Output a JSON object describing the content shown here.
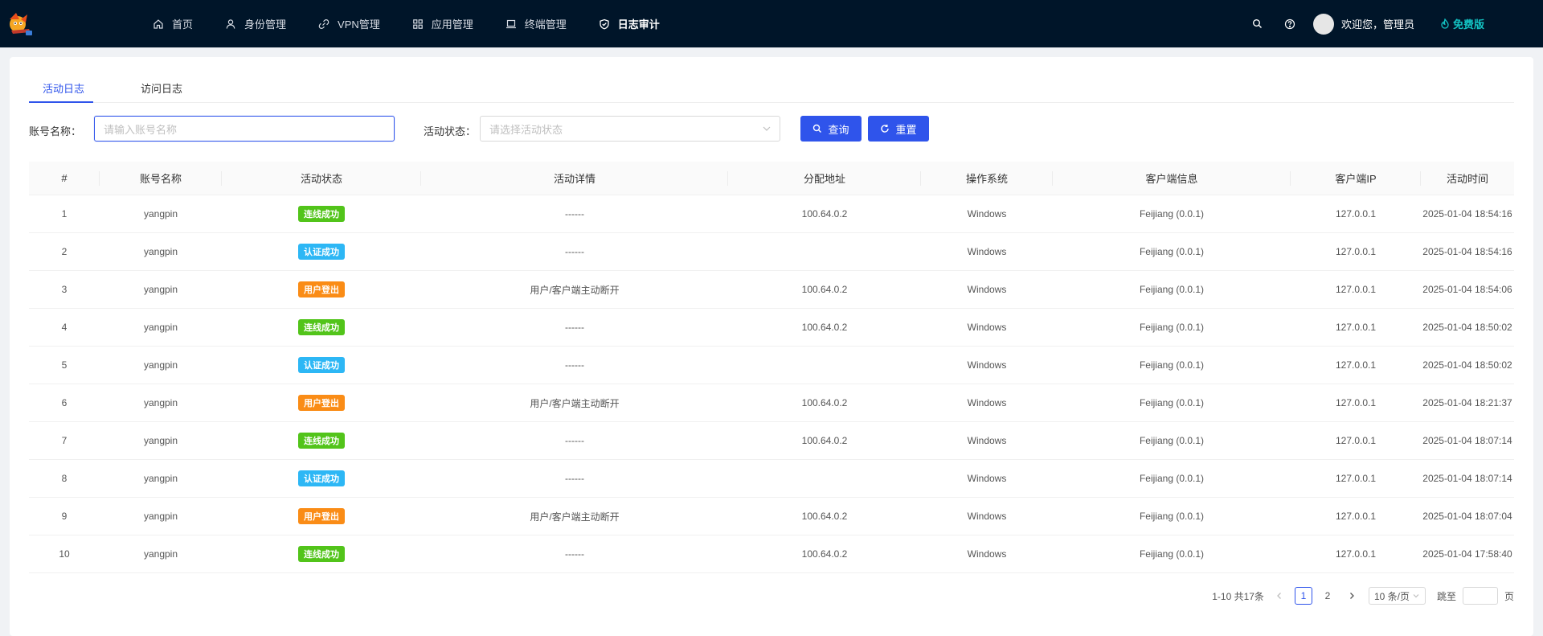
{
  "nav": {
    "items": [
      {
        "label": "首页",
        "icon": "home-icon"
      },
      {
        "label": "身份管理",
        "icon": "user-icon"
      },
      {
        "label": "VPN管理",
        "icon": "link-icon"
      },
      {
        "label": "应用管理",
        "icon": "apps-icon"
      },
      {
        "label": "终端管理",
        "icon": "laptop-icon"
      },
      {
        "label": "日志审计",
        "icon": "shield-icon",
        "active": true
      }
    ]
  },
  "header": {
    "welcome": "欢迎您，管理员",
    "edition": "免费版"
  },
  "tabs": [
    "活动日志",
    "访问日志"
  ],
  "filters": {
    "account_label": "账号名称：",
    "account_placeholder": "请输入账号名称",
    "status_label": "活动状态：",
    "status_placeholder": "请选择活动状态",
    "search_label": "查询",
    "reset_label": "重置"
  },
  "colors": {
    "accent": "#2f54eb",
    "success": "#52c41a",
    "auth": "#2db7f5",
    "logout": "#fa8c16"
  },
  "table": {
    "columns": [
      "#",
      "账号名称",
      "活动状态",
      "活动详情",
      "分配地址",
      "操作系统",
      "客户端信息",
      "客户端IP",
      "活动时间"
    ],
    "rows": [
      {
        "no": "1",
        "account": "yangpin",
        "status": "连线成功",
        "status_type": "success",
        "detail": "------",
        "address": "100.64.0.2",
        "os": "Windows",
        "client": "Feijiang (0.0.1)",
        "ip": "127.0.0.1",
        "time": "2025-01-04 18:54:16"
      },
      {
        "no": "2",
        "account": "yangpin",
        "status": "认证成功",
        "status_type": "auth",
        "detail": "------",
        "address": "",
        "os": "Windows",
        "client": "Feijiang (0.0.1)",
        "ip": "127.0.0.1",
        "time": "2025-01-04 18:54:16"
      },
      {
        "no": "3",
        "account": "yangpin",
        "status": "用户登出",
        "status_type": "logout",
        "detail": "用户/客户端主动断开",
        "address": "100.64.0.2",
        "os": "Windows",
        "client": "Feijiang (0.0.1)",
        "ip": "127.0.0.1",
        "time": "2025-01-04 18:54:06"
      },
      {
        "no": "4",
        "account": "yangpin",
        "status": "连线成功",
        "status_type": "success",
        "detail": "------",
        "address": "100.64.0.2",
        "os": "Windows",
        "client": "Feijiang (0.0.1)",
        "ip": "127.0.0.1",
        "time": "2025-01-04 18:50:02"
      },
      {
        "no": "5",
        "account": "yangpin",
        "status": "认证成功",
        "status_type": "auth",
        "detail": "------",
        "address": "",
        "os": "Windows",
        "client": "Feijiang (0.0.1)",
        "ip": "127.0.0.1",
        "time": "2025-01-04 18:50:02"
      },
      {
        "no": "6",
        "account": "yangpin",
        "status": "用户登出",
        "status_type": "logout",
        "detail": "用户/客户端主动断开",
        "address": "100.64.0.2",
        "os": "Windows",
        "client": "Feijiang (0.0.1)",
        "ip": "127.0.0.1",
        "time": "2025-01-04 18:21:37"
      },
      {
        "no": "7",
        "account": "yangpin",
        "status": "连线成功",
        "status_type": "success",
        "detail": "------",
        "address": "100.64.0.2",
        "os": "Windows",
        "client": "Feijiang (0.0.1)",
        "ip": "127.0.0.1",
        "time": "2025-01-04 18:07:14"
      },
      {
        "no": "8",
        "account": "yangpin",
        "status": "认证成功",
        "status_type": "auth",
        "detail": "------",
        "address": "",
        "os": "Windows",
        "client": "Feijiang (0.0.1)",
        "ip": "127.0.0.1",
        "time": "2025-01-04 18:07:14"
      },
      {
        "no": "9",
        "account": "yangpin",
        "status": "用户登出",
        "status_type": "logout",
        "detail": "用户/客户端主动断开",
        "address": "100.64.0.2",
        "os": "Windows",
        "client": "Feijiang (0.0.1)",
        "ip": "127.0.0.1",
        "time": "2025-01-04 18:07:04"
      },
      {
        "no": "10",
        "account": "yangpin",
        "status": "连线成功",
        "status_type": "success",
        "detail": "------",
        "address": "100.64.0.2",
        "os": "Windows",
        "client": "Feijiang (0.0.1)",
        "ip": "127.0.0.1",
        "time": "2025-01-04 17:58:40"
      }
    ]
  },
  "pagination": {
    "total_text": "1-10 共17条",
    "pages": [
      "1",
      "2"
    ],
    "current": "1",
    "page_size": "10 条/页",
    "jump_label": "跳至",
    "page_suffix": "页"
  }
}
